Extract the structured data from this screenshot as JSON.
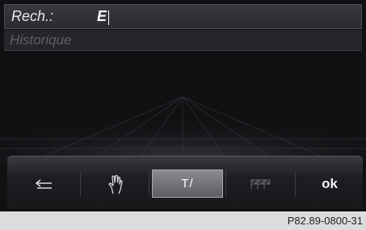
{
  "search": {
    "label": "Rech.:",
    "value": "E"
  },
  "history": {
    "label": "Historique"
  },
  "toolbar": {
    "buttons": [
      {
        "id": "back",
        "icon": "back-arrow-icon"
      },
      {
        "id": "handwriting",
        "icon": "handwriting-hand-icon"
      },
      {
        "id": "text-mode",
        "label": "T/",
        "active": true
      },
      {
        "id": "destination-flags",
        "icon": "checkered-flags-icon",
        "disabled": true
      },
      {
        "id": "ok",
        "label": "ok"
      }
    ]
  },
  "caption": "P82.89-0800-31",
  "colors": {
    "screen": "#111114",
    "accent_active": "#7a7a80",
    "caption_bg": "#dcdcdc"
  }
}
